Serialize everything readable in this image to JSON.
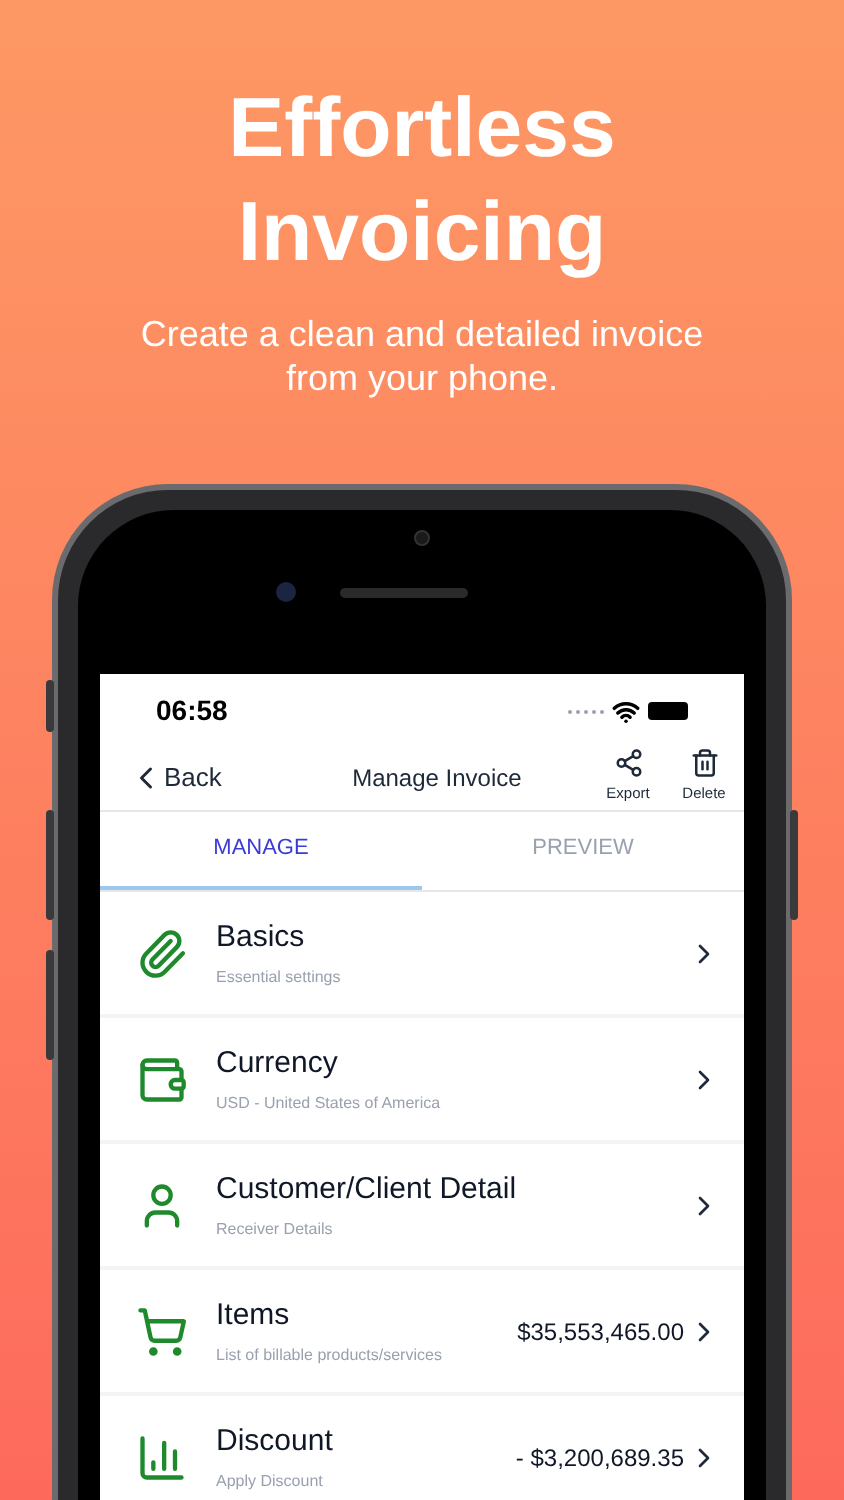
{
  "headline": "Effortless Invoicing",
  "subtitle": "Create a clean and detailed invoice from your phone.",
  "status_bar": {
    "time": "06:58"
  },
  "nav": {
    "back": "Back",
    "title": "Manage Invoice",
    "actions": [
      {
        "kind": "share",
        "label": "Export"
      },
      {
        "kind": "trash",
        "label": "Delete"
      }
    ]
  },
  "tabs": [
    {
      "label": "MANAGE",
      "selected": true
    },
    {
      "label": "PREVIEW",
      "selected": false
    }
  ],
  "rows": [
    {
      "kind": "paperclip",
      "title": "Basics",
      "subtitle": "Essential settings"
    },
    {
      "kind": "wallet",
      "title": "Currency",
      "subtitle": "USD - United States of America"
    },
    {
      "kind": "user",
      "title": "Customer/Client Detail",
      "subtitle": "Receiver Details"
    },
    {
      "kind": "cart",
      "title": "Items",
      "subtitle": "List of billable products/services",
      "value": "$35,553,465.00"
    },
    {
      "kind": "chart",
      "title": "Discount",
      "subtitle": "Apply Discount",
      "value": "- $3,200,689.35"
    }
  ]
}
